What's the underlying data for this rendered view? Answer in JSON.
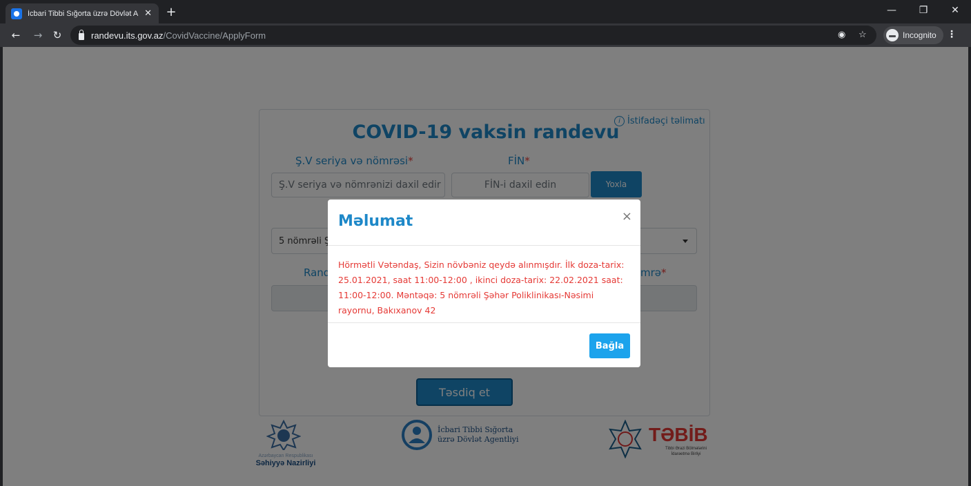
{
  "browser": {
    "tab_title": "İcbari Tibbi Sığorta üzrə Dövlət A",
    "url_host": "randevu.its.gov.az",
    "url_path": "/CovidVaccine/ApplyForm",
    "incognito_label": "Incognito"
  },
  "form": {
    "help_link": "İstifadəçi təlimatı",
    "title": "COVID-19 vaksin randevu",
    "id_label": "Ş.V seriya və nömrəsi",
    "id_placeholder": "Ş.V seriya və nömrənizi daxil edir",
    "fin_label": "FİN",
    "fin_placeholder": "FİN-i daxil edin",
    "check_button": "Yoxla",
    "required_mark": "*",
    "select_value": "5 nömrəli Ş",
    "date_label_partial": "Rand",
    "phone_label_partial": "mrə",
    "submit_button": "Təsdiq et"
  },
  "logos": {
    "ministry_line1": "Azərbaycan Respublikası",
    "ministry_line2": "Səhiyyə Nazirliyi",
    "agency_line1": "İcbari Tibbi Sığorta",
    "agency_line2": "üzrə Dövlət Agentliyi",
    "tabib_name": "TƏBİB",
    "tabib_line1": "Tibbi Ərazi Bölmələrini",
    "tabib_line2": "İdarəetmə Birliyi"
  },
  "modal": {
    "title": "Məlumat",
    "message": "Hörmətli Vətəndaş, Sizin növbəniz qeydə alınmışdır. İlk doza-tarix: 25.01.2021, saat 11:00-12:00 , ikinci doza-tarix: 22.02.2021 saat: 11:00-12:00. Məntəqə: 5 nömrəli Şəhər Poliklinikası-Nəsimi rayornu, Bakıxanov 42",
    "close_button": "Bağla"
  },
  "colors": {
    "accent": "#1e88c8",
    "error_text": "#e53935",
    "modal_button": "#1ca3ec"
  }
}
